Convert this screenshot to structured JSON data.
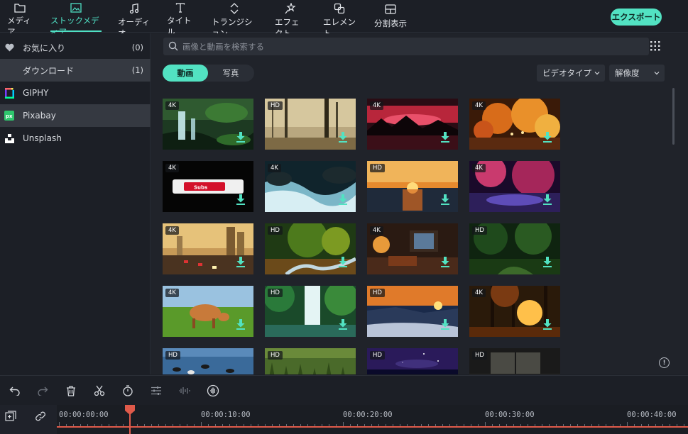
{
  "toolbar": {
    "items": [
      {
        "label": "メディア",
        "icon": "folder-icon"
      },
      {
        "label": "ストックメディア",
        "icon": "stock-media-icon",
        "active": true
      },
      {
        "label": "オーディオ",
        "icon": "music-note-icon"
      },
      {
        "label": "タイトル",
        "icon": "text-t-icon"
      },
      {
        "label": "トランジション",
        "icon": "transition-icon"
      },
      {
        "label": "エフェクト",
        "icon": "effect-sparkle-icon"
      },
      {
        "label": "エレメント",
        "icon": "element-icon"
      },
      {
        "label": "分割表示",
        "icon": "split-screen-icon"
      }
    ],
    "export_label": "エクスポート"
  },
  "sidebar": {
    "items": [
      {
        "label": "お気に入り",
        "count": "(0)",
        "icon": "heart-icon"
      },
      {
        "label": "ダウンロード",
        "count": "(1)",
        "icon": ""
      },
      {
        "label": "GIPHY",
        "count": "",
        "icon": "giphy-logo-icon"
      },
      {
        "label": "Pixabay",
        "count": "",
        "icon": "pixabay-logo-icon",
        "selected": true
      },
      {
        "label": "Unsplash",
        "count": "",
        "icon": "unsplash-logo-icon"
      }
    ]
  },
  "search": {
    "placeholder": "画像と動画を検索する"
  },
  "tabs": [
    {
      "label": "動画",
      "active": true
    },
    {
      "label": "写真",
      "active": false
    }
  ],
  "filters": {
    "video_type": "ビデオタイプ",
    "resolution": "解像度"
  },
  "thumbnails": [
    {
      "badge": "4K",
      "theme": "waterfall-forest"
    },
    {
      "badge": "HD",
      "theme": "misty-forest"
    },
    {
      "badge": "4K",
      "theme": "red-sky-mountains"
    },
    {
      "badge": "4K",
      "theme": "autumn-lights"
    },
    {
      "badge": "4K",
      "theme": "subscribe-button",
      "inner_text": "Subs"
    },
    {
      "badge": "4K",
      "theme": "rapids"
    },
    {
      "badge": "HD",
      "theme": "ocean-sunset"
    },
    {
      "badge": "4K",
      "theme": "purple-river"
    },
    {
      "badge": "4K",
      "theme": "city-traffic"
    },
    {
      "badge": "HD",
      "theme": "forest-stream"
    },
    {
      "badge": "4K",
      "theme": "cozy-room"
    },
    {
      "badge": "HD",
      "theme": "green-forest"
    },
    {
      "badge": "4K",
      "theme": "cow-meadow"
    },
    {
      "badge": "HD",
      "theme": "tropical-waterfall"
    },
    {
      "badge": "HD",
      "theme": "beach-sunset"
    },
    {
      "badge": "4K",
      "theme": "sun-through-trees"
    },
    {
      "badge": "HD",
      "theme": "ducks-lake"
    },
    {
      "badge": "HD",
      "theme": "grass"
    },
    {
      "badge": "HD",
      "theme": "night-sky"
    },
    {
      "badge": "HD",
      "theme": "dark-window"
    }
  ],
  "timeline": {
    "timecodes": [
      "00:00:00:00",
      "00:00:10:00",
      "00:00:20:00",
      "00:00:30:00",
      "00:00:40:00"
    ]
  },
  "colors": {
    "accent": "#52e2c2",
    "playhead": "#e05a4a",
    "background": "#1c1f26"
  }
}
